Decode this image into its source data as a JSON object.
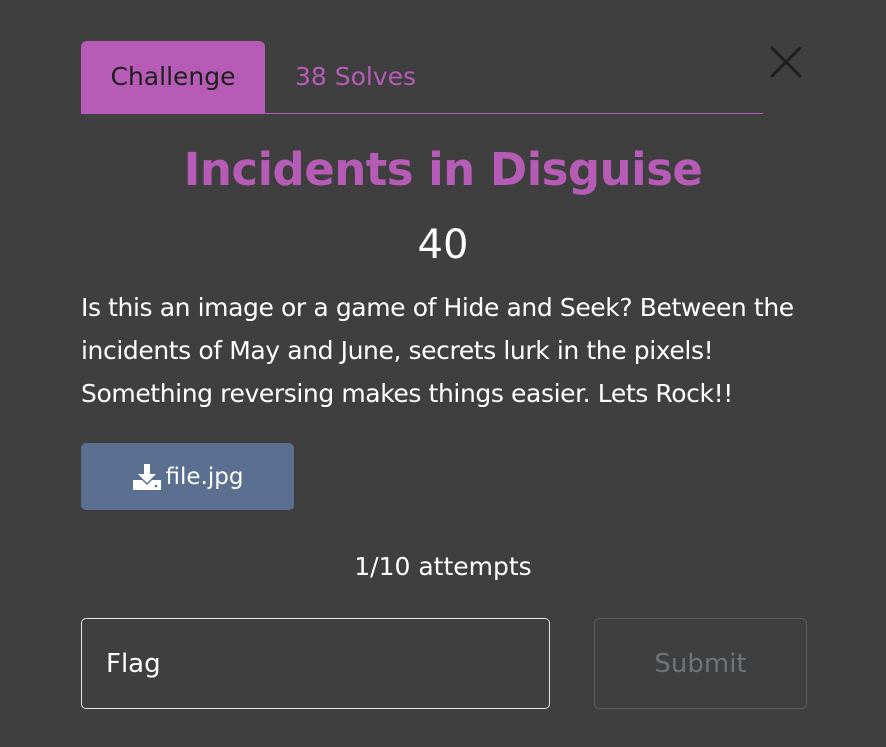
{
  "tabs": {
    "challenge_label": "Challenge",
    "solves_label": "38 Solves"
  },
  "challenge": {
    "title": "Incidents in Disguise",
    "points": "40",
    "description": "Is this an image or a game of Hide and Seek? Between the incidents of May and June, secrets lurk in the pixels! Something reversing makes things easier. Lets Rock!!"
  },
  "file": {
    "name": "file.jpg",
    "icon": "download-icon"
  },
  "attempts": "1/10 attempts",
  "form": {
    "flag_placeholder": "Flag",
    "flag_value": "",
    "submit_label": "Submit"
  },
  "icons": {
    "close": "close-icon"
  },
  "colors": {
    "accent": "#b65cb7",
    "background": "#3f3f3f",
    "file_button": "#5b7090",
    "submit_disabled_text": "#6f7478"
  }
}
